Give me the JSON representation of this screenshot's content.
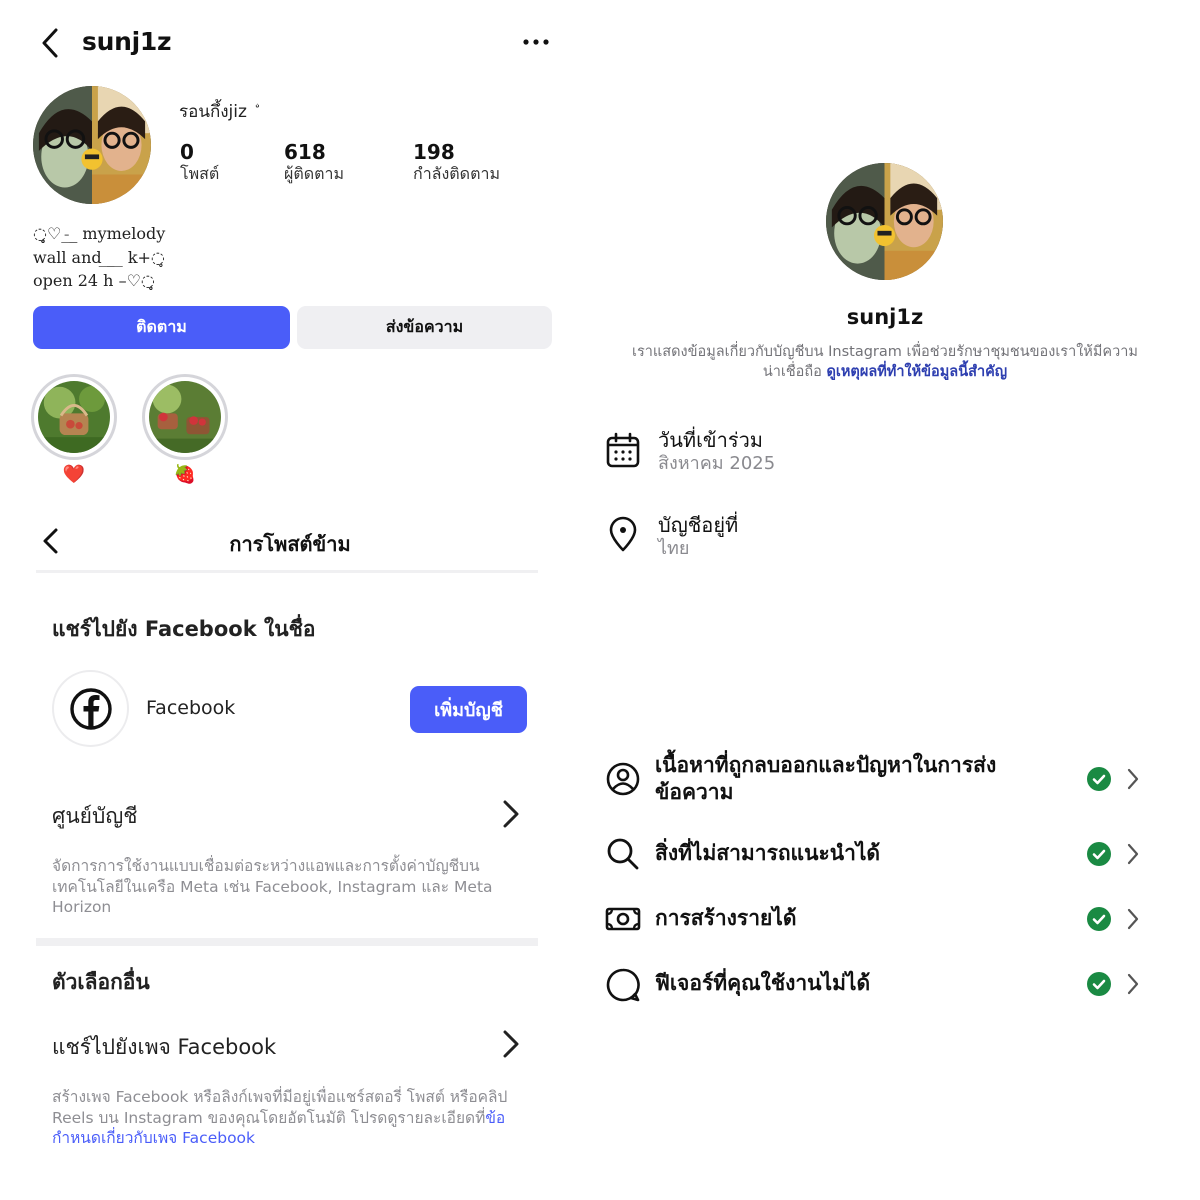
{
  "profile": {
    "username": "sunj1z",
    "display_name": "รอนกึ้งjiz ۨ",
    "stats": [
      {
        "value": "0",
        "label": "โพสต์"
      },
      {
        "value": "618",
        "label": "ผู้ติดตาม"
      },
      {
        "value": "198",
        "label": "กำลังติดตาม"
      }
    ],
    "bio": [
      "◌̥̥̥♡_̵_̲ mymelody",
      "wall and ̲_̲_ k+◌̥",
      "open 24 h –♡◌̥̥"
    ],
    "buttons": {
      "follow": "ติดตาม",
      "message": "ส่งข้อความ"
    },
    "highlights": [
      {
        "label": "❤️"
      },
      {
        "label": "🍓"
      }
    ]
  },
  "crosspost": {
    "title": "การโพสต์ข้าม",
    "share_heading": "แชร์ไปยัง Facebook ในชื่อ",
    "facebook_label": "Facebook",
    "add_account": "เพิ่มบัญชี",
    "accounts_center": {
      "title": "ศูนย์บัญชี",
      "desc": "จัดการการใช้งานแบบเชื่อมต่อระหว่างแอพและการตั้งค่าบัญชีบนเทคโนโลยีในเครือ Meta เช่น Facebook, Instagram และ Meta Horizon"
    },
    "other_heading": "ตัวเลือกอื่น",
    "share_page": {
      "title": "แชร์ไปยังเพจ Facebook",
      "desc": "สร้างเพจ Facebook หรือลิงก์เพจที่มีอยู่เพื่อแชร์สตอรี่ โพสต์ หรือคลิป Reels บน Instagram ของคุณโดยอัตโนมัติ โปรดดูรายละเอียดที่",
      "link": "ข้อกำหนดเกี่ยวกับเพจ Facebook"
    }
  },
  "about": {
    "username": "sunj1z",
    "info_text": "เราแสดงข้อมูลเกี่ยวกับบัญชีบน Instagram เพื่อช่วยรักษาชุมชนของเราให้มีความน่าเชื่อถือ",
    "info_link": "ดูเหตุผลที่ทำให้ข้อมูลนี้สำคัญ",
    "date_joined": {
      "label": "วันที่เข้าร่วม",
      "value": "สิงหาคม 2025"
    },
    "account_based": {
      "label": "บัญชีอยู่ที่",
      "value": "ไทย"
    },
    "status_items": [
      {
        "label": "เนื้อหาที่ถูกลบออกและปัญหาในการส่งข้อความ",
        "icon": "user-circle-icon"
      },
      {
        "label": "สิ่งที่ไม่สามารถแนะนำได้",
        "icon": "search-icon"
      },
      {
        "label": "การสร้างรายได้",
        "icon": "money-icon"
      },
      {
        "label": "ฟีเจอร์ที่คุณใช้งานไม่ได้",
        "icon": "chat-bubble-icon"
      }
    ],
    "check_color": "#1a8a43"
  },
  "colors": {
    "accent": "#4a5df9",
    "link": "#2e3fb0"
  }
}
